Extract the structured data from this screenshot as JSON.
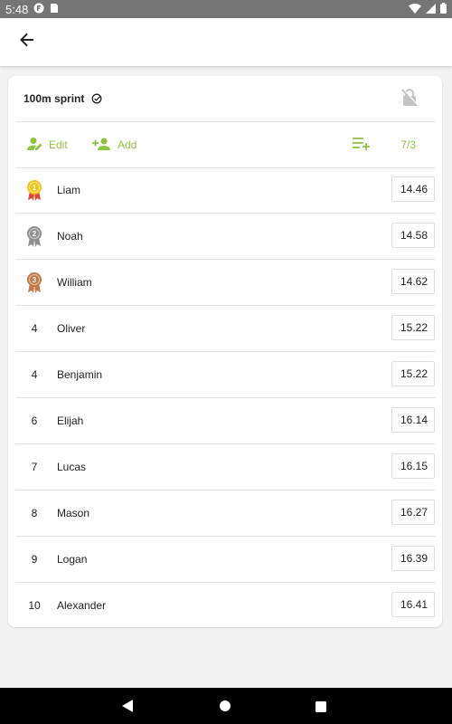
{
  "status_bar": {
    "time": "5:48",
    "icons": [
      "notification-icon",
      "sim-card-icon",
      "wifi-icon",
      "cellular-signal-icon",
      "battery-icon"
    ]
  },
  "app_bar": {
    "back_icon": "arrow-back-icon"
  },
  "event": {
    "title": "100m sprint",
    "status_icon": "check-circle-icon",
    "lock_icon": "lock-off-icon"
  },
  "toolbar": {
    "edit_label": "Edit",
    "add_label": "Add",
    "count": "7/3",
    "accent_color": "#8cc63f"
  },
  "results": [
    {
      "rank": "1",
      "medal": "gold",
      "name": "Liam",
      "time": "14.46"
    },
    {
      "rank": "2",
      "medal": "silver",
      "name": "Noah",
      "time": "14.58"
    },
    {
      "rank": "3",
      "medal": "bronze",
      "name": "William",
      "time": "14.62"
    },
    {
      "rank": "4",
      "medal": "",
      "name": "Oliver",
      "time": "15.22"
    },
    {
      "rank": "4",
      "medal": "",
      "name": "Benjamin",
      "time": "15.22"
    },
    {
      "rank": "6",
      "medal": "",
      "name": "Elijah",
      "time": "16.14"
    },
    {
      "rank": "7",
      "medal": "",
      "name": "Lucas",
      "time": "16.15"
    },
    {
      "rank": "8",
      "medal": "",
      "name": "Mason",
      "time": "16.27"
    },
    {
      "rank": "9",
      "medal": "",
      "name": "Logan",
      "time": "16.39"
    },
    {
      "rank": "10",
      "medal": "",
      "name": "Alexander",
      "time": "16.41"
    }
  ],
  "medal_colors": {
    "gold": "#f2c318",
    "silver": "#8f8f8f",
    "bronze": "#c27a4a",
    "ribbon": "#e0453a"
  },
  "nav_bar": {
    "icons": [
      "nav-back-icon",
      "nav-home-icon",
      "nav-recents-icon"
    ]
  }
}
